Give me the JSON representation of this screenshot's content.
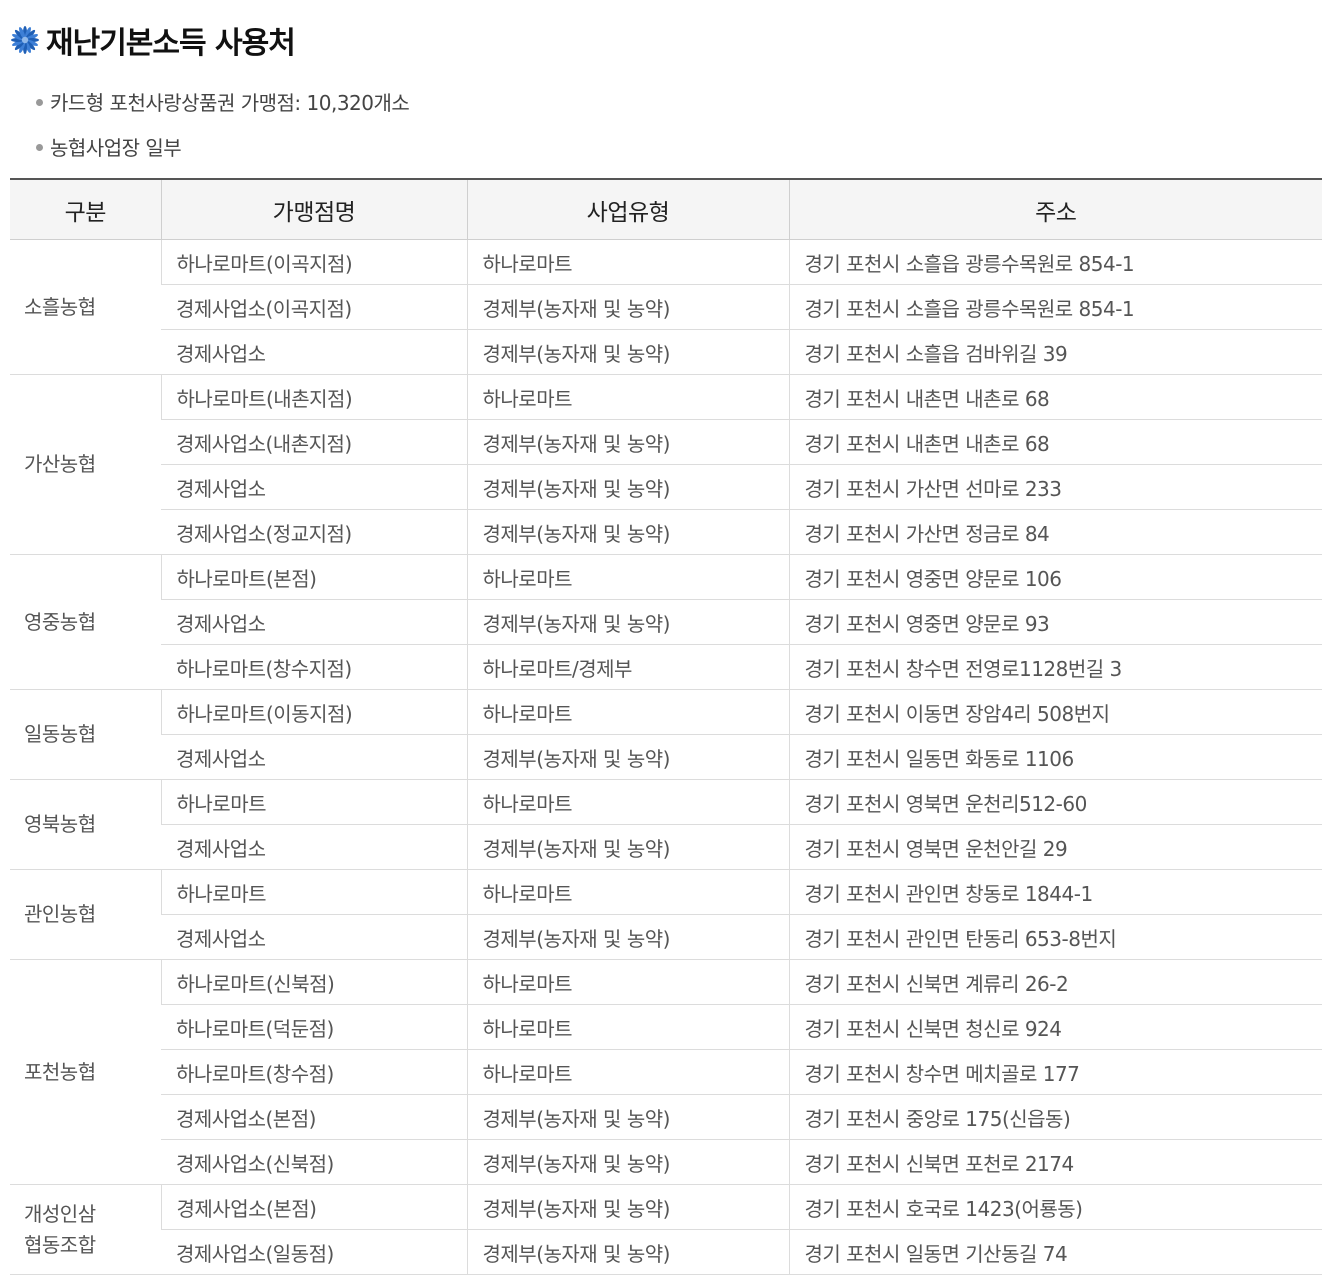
{
  "title": "재난기본소득 사용처",
  "icon": "blue-flower-icon",
  "bullets": [
    "카드형 포천사랑상품권 가맹점: 10,320개소",
    "농협사업장 일부"
  ],
  "table": {
    "headers": [
      "구분",
      "가맹점명",
      "사업유형",
      "주소"
    ],
    "groups": [
      {
        "name": "소흘농협",
        "rows": [
          [
            "하나로마트(이곡지점)",
            "하나로마트",
            "경기 포천시 소흘읍 광릉수목원로 854-1"
          ],
          [
            "경제사업소(이곡지점)",
            "경제부(농자재 및 농약)",
            "경기 포천시 소흘읍 광릉수목원로 854-1"
          ],
          [
            "경제사업소",
            "경제부(농자재 및 농약)",
            "경기 포천시 소흘읍 검바위길 39"
          ]
        ]
      },
      {
        "name": "가산농협",
        "rows": [
          [
            "하나로마트(내촌지점)",
            "하나로마트",
            "경기 포천시 내촌면 내촌로 68"
          ],
          [
            "경제사업소(내촌지점)",
            "경제부(농자재 및 농약)",
            "경기 포천시 내촌면 내촌로 68"
          ],
          [
            "경제사업소",
            "경제부(농자재 및 농약)",
            "경기 포천시 가산면 선마로 233"
          ],
          [
            "경제사업소(정교지점)",
            "경제부(농자재 및 농약)",
            "경기 포천시 가산면 정금로 84"
          ]
        ]
      },
      {
        "name": "영중농협",
        "rows": [
          [
            "하나로마트(본점)",
            "하나로마트",
            "경기 포천시 영중면 양문로 106"
          ],
          [
            "경제사업소",
            "경제부(농자재 및 농약)",
            "경기 포천시 영중면 양문로 93"
          ],
          [
            "하나로마트(창수지점)",
            "하나로마트/경제부",
            "경기 포천시 창수면 전영로1128번길 3"
          ]
        ]
      },
      {
        "name": "일동농협",
        "rows": [
          [
            "하나로마트(이동지점)",
            "하나로마트",
            "경기 포천시 이동면 장암4리 508번지"
          ],
          [
            "경제사업소",
            "경제부(농자재 및 농약)",
            "경기 포천시 일동면 화동로 1106"
          ]
        ]
      },
      {
        "name": "영북농협",
        "rows": [
          [
            "하나로마트",
            "하나로마트",
            "경기 포천시 영북면 운천리512-60"
          ],
          [
            "경제사업소",
            "경제부(농자재 및 농약)",
            "경기 포천시 영북면 운천안길 29"
          ]
        ]
      },
      {
        "name": "관인농협",
        "rows": [
          [
            "하나로마트",
            "하나로마트",
            "경기 포천시 관인면 창동로 1844-1"
          ],
          [
            "경제사업소",
            "경제부(농자재 및 농약)",
            "경기 포천시 관인면 탄동리 653-8번지"
          ]
        ]
      },
      {
        "name": "포천농협",
        "rows": [
          [
            "하나로마트(신북점)",
            "하나로마트",
            "경기 포천시 신북면 계류리 26-2"
          ],
          [
            "하나로마트(덕둔점)",
            "하나로마트",
            "경기 포천시 신북면 청신로 924"
          ],
          [
            "하나로마트(창수점)",
            "하나로마트",
            "경기 포천시 창수면 메치골로 177"
          ],
          [
            "경제사업소(본점)",
            "경제부(농자재 및 농약)",
            "경기 포천시 중앙로 175(신읍동)"
          ],
          [
            "경제사업소(신북점)",
            "경제부(농자재 및 농약)",
            "경기 포천시 신북면 포천로 2174"
          ]
        ]
      },
      {
        "name": "개성인삼\n협동조합",
        "rows": [
          [
            "경제사업소(본점)",
            "경제부(농자재 및 농약)",
            "경기 포천시 호국로 1423(어룡동)"
          ],
          [
            "경제사업소(일동점)",
            "경제부(농자재 및 농약)",
            "경기 포천시 일동면 기산동길 74"
          ]
        ]
      }
    ]
  }
}
